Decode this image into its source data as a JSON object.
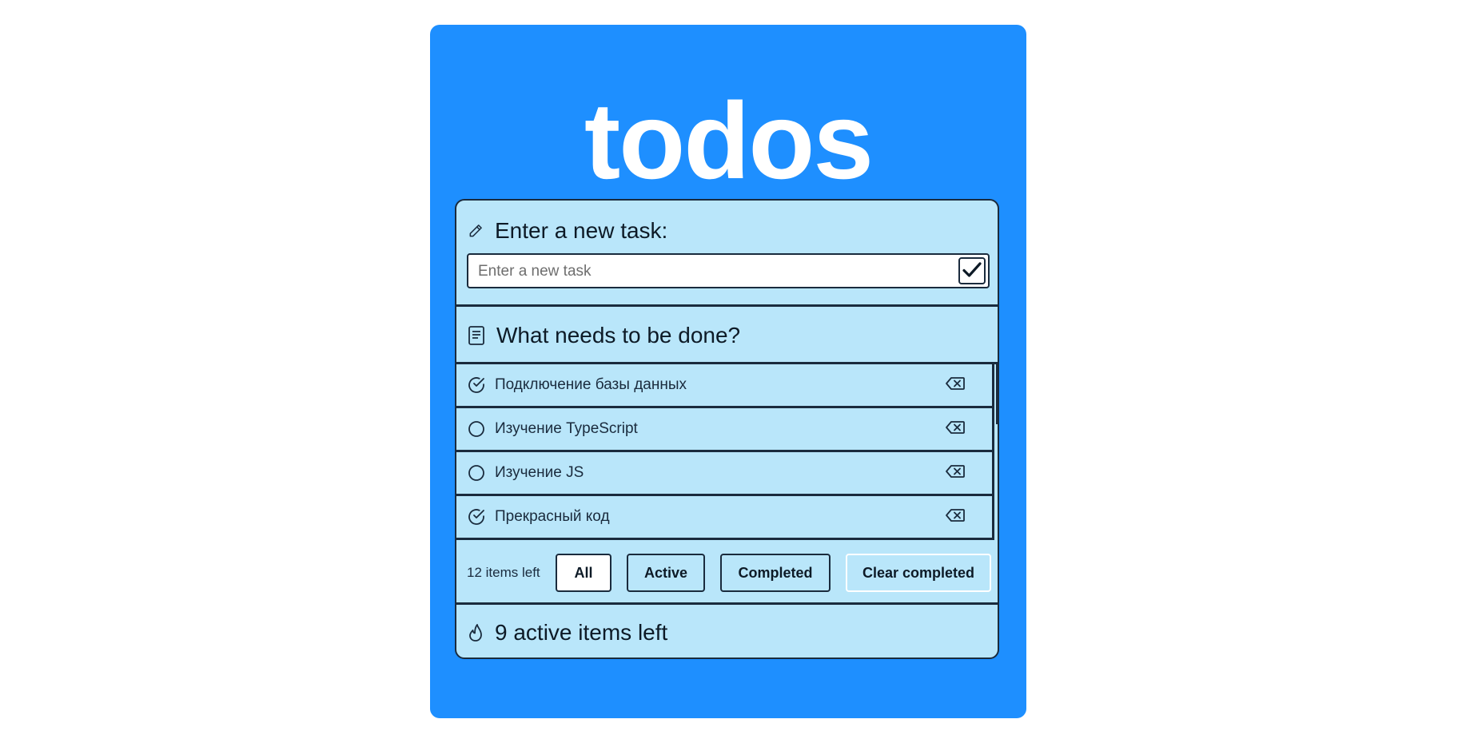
{
  "app": {
    "title": "todos"
  },
  "new_task": {
    "label": "Enter a new task:",
    "placeholder": "Enter a new task",
    "value": ""
  },
  "list_header": {
    "label": "What needs to be done?"
  },
  "tasks": [
    {
      "text": "Подключение базы данных",
      "completed": true
    },
    {
      "text": "Изучение TypeScript",
      "completed": false
    },
    {
      "text": "Изучение JS",
      "completed": false
    },
    {
      "text": "Прекрасный код",
      "completed": true
    }
  ],
  "footer": {
    "items_left": "12 items left",
    "filters": {
      "all": "All",
      "active": "Active",
      "completed": "Completed"
    },
    "selected_filter": "All",
    "clear_completed": "Clear completed"
  },
  "summary": {
    "label": "9 active items left"
  },
  "colors": {
    "accent_blue": "#1e8fff",
    "panel_bg": "#b9e6fa",
    "border_dark": "#1a2b3d",
    "title_text": "#ffffff"
  },
  "icons": {
    "new_task": "pencil-icon",
    "submit": "check-icon",
    "list_header": "document-icon",
    "task_done": "check-circle-icon",
    "task_open": "circle-icon",
    "delete": "backspace-icon",
    "summary": "flame-icon"
  }
}
